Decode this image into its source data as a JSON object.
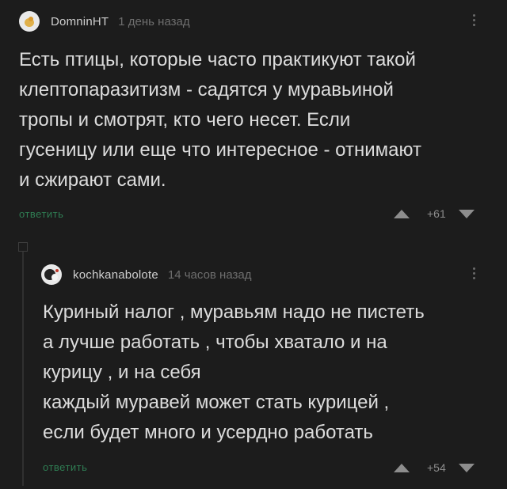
{
  "comments": [
    {
      "author": "DomninHT",
      "time": "1 день назад",
      "text": "Есть птицы, которые часто практикуют такой\nклептопаразитизм - садятся у муравьиной\nтропы и смотрят, кто чего несет. Если\nгусеницу или еще что интересное - отнимают\nи сжирают сами.",
      "reply_label": "ответить",
      "score": "+61",
      "avatar_icon": "bird-avatar-icon"
    },
    {
      "author": "kochkanabolote",
      "time": "14 часов назад",
      "text": "Куриный налог , муравьям надо не пистеть\nа лучше работать , чтобы хватало и на\nкурицу , и на себя\nкаждый муравей может стать курицей ,\nесли будет много и усердно работать",
      "reply_label": "ответить",
      "score": "+54",
      "avatar_icon": "bird-avatar-icon"
    }
  ],
  "colors": {
    "background": "#1c1c1c",
    "reply_link": "#2f7d53",
    "muted": "#8d8d8d"
  }
}
